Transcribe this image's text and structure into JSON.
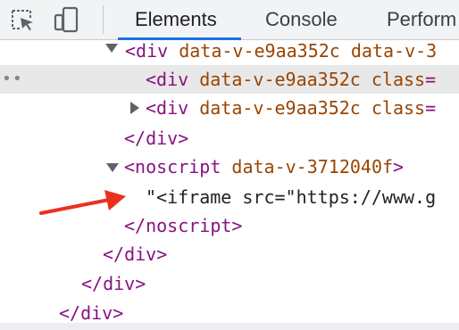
{
  "toolbar": {
    "inspect_icon": "inspect-element-icon",
    "device_icon": "device-toolbar-icon",
    "tabs": [
      {
        "label": "Elements",
        "active": true
      },
      {
        "label": "Console",
        "active": false
      },
      {
        "label": "Perform",
        "active": false
      }
    ]
  },
  "tree": {
    "lines": [
      {
        "open": "<div",
        "attr": "data-v-e9aa352c data-v-3",
        "eq": "",
        "close": ""
      },
      {
        "open": "<div",
        "attr": "data-v-e9aa352c class",
        "eq": "=",
        "close": ""
      },
      {
        "open": "<div",
        "attr": "data-v-e9aa352c class",
        "eq": "=",
        "close": ""
      },
      {
        "close_tag": "</div>"
      },
      {
        "open": "<noscript",
        "attr": "data-v-3712040f",
        "close": ">"
      },
      {
        "text": "\"<iframe src=\"https://www.g"
      },
      {
        "close_tag": "</noscript>"
      },
      {
        "close_tag": "</div>"
      },
      {
        "close_tag": "</div>"
      },
      {
        "close_tag": "</div>"
      }
    ],
    "selected_marker": "••"
  },
  "colors": {
    "tag": "#881280",
    "attr": "#994500",
    "accent": "#1a73e8",
    "annotation_arrow": "#e8321e"
  }
}
